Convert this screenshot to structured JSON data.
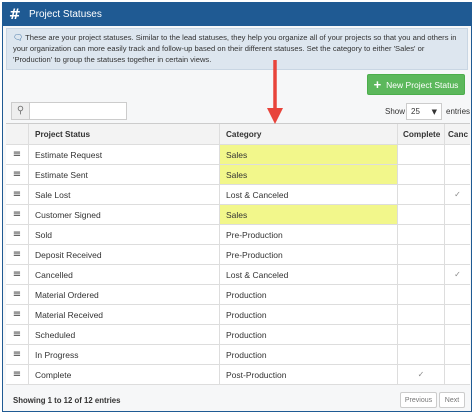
{
  "panel": {
    "title": "Project Statuses",
    "hash_glyph": "#",
    "info": "These are your project statuses. Similar to the lead statuses, they help you organize all of your projects so that you and others in your organization can more easily track and follow-up based on their different statuses. Set the category to either 'Sales' or 'Production' to group the statuses together in certain views."
  },
  "toolbar": {
    "new_button_label": "New Project Status",
    "show_label": "Show",
    "page_size": "25",
    "entries_label": "entries"
  },
  "table": {
    "headers": [
      "Project Status",
      "Category",
      "Complete",
      "Canc"
    ],
    "rows": [
      {
        "status": "Estimate Request",
        "category": "Sales",
        "complete": "",
        "canceled": ""
      },
      {
        "status": "Estimate Sent",
        "category": "Sales",
        "complete": "",
        "canceled": ""
      },
      {
        "status": "Sale Lost",
        "category": "Lost & Canceled",
        "complete": "",
        "canceled": "✓"
      },
      {
        "status": "Customer Signed",
        "category": "Sales",
        "complete": "",
        "canceled": ""
      },
      {
        "status": "Sold",
        "category": "Pre-Production",
        "complete": "",
        "canceled": ""
      },
      {
        "status": "Deposit Received",
        "category": "Pre-Production",
        "complete": "",
        "canceled": ""
      },
      {
        "status": "Cancelled",
        "category": "Lost & Canceled",
        "complete": "",
        "canceled": "✓"
      },
      {
        "status": "Material Ordered",
        "category": "Production",
        "complete": "",
        "canceled": ""
      },
      {
        "status": "Material Received",
        "category": "Production",
        "complete": "",
        "canceled": ""
      },
      {
        "status": "Scheduled",
        "category": "Production",
        "complete": "",
        "canceled": ""
      },
      {
        "status": "In Progress",
        "category": "Production",
        "complete": "",
        "canceled": ""
      },
      {
        "status": "Complete",
        "category": "Post-Production",
        "complete": "✓",
        "canceled": ""
      }
    ]
  },
  "footer": {
    "summary": "Showing 1 to 12 of 12 entries",
    "previous_label": "Previous",
    "next_label": "Next"
  },
  "colors": {
    "header_blue": "#1f5a93",
    "sales_highlight": "#f2f78b",
    "button_green": "#5cb85c",
    "arrow_red": "#e8443b"
  }
}
